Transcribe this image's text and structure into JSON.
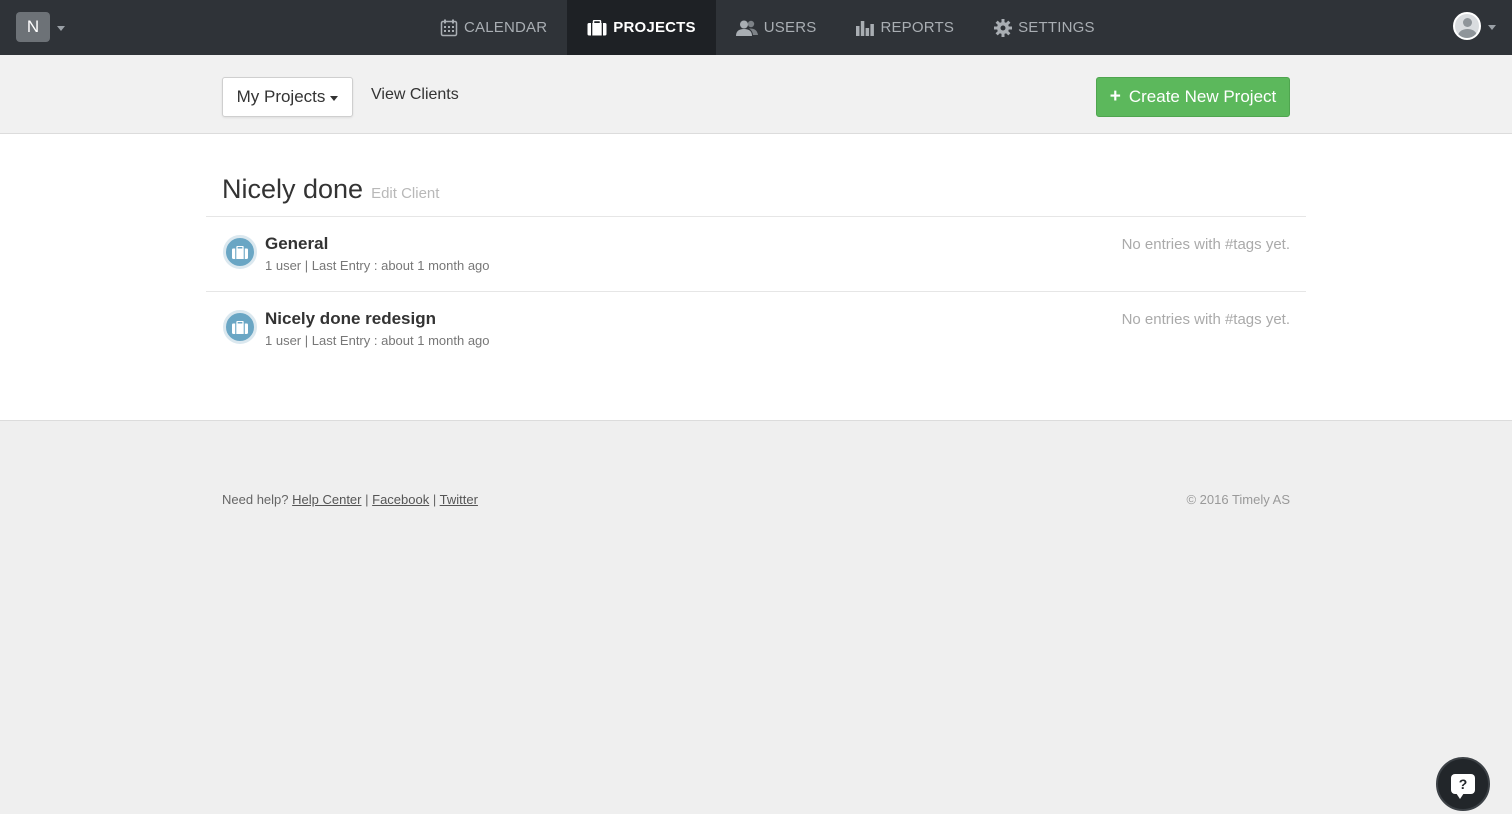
{
  "topbar": {
    "workspace_initial": "N",
    "nav": [
      {
        "label": "CALENDAR",
        "icon": "calendar-icon",
        "active": false
      },
      {
        "label": "PROJECTS",
        "icon": "briefcase-icon",
        "active": true
      },
      {
        "label": "USERS",
        "icon": "users-icon",
        "active": false
      },
      {
        "label": "REPORTS",
        "icon": "bar-chart-icon",
        "active": false
      },
      {
        "label": "SETTINGS",
        "icon": "gear-icon",
        "active": false
      }
    ]
  },
  "subbar": {
    "dropdown_label": "My Projects",
    "view_clients": "View Clients",
    "create_label": "Create New Project"
  },
  "client": {
    "name": "Nicely done",
    "edit_label": "Edit Client"
  },
  "projects": [
    {
      "title": "General",
      "meta": "1 user | Last Entry : about 1 month ago",
      "tags": "No entries with #tags yet."
    },
    {
      "title": "Nicely done redesign",
      "meta": "1 user | Last Entry : about 1 month ago",
      "tags": "No entries with #tags yet."
    }
  ],
  "footer": {
    "need_help": "Need help?",
    "help_center": "Help Center",
    "facebook": "Facebook",
    "twitter": "Twitter",
    "separator": "|",
    "copyright": "© 2016 Timely AS"
  },
  "help_button": {
    "symbol": "?"
  },
  "colors": {
    "topbar": "#2f3338",
    "active_tab": "#1e2125",
    "create_button": "#5cb85c",
    "project_icon": "#6aa6c4"
  }
}
